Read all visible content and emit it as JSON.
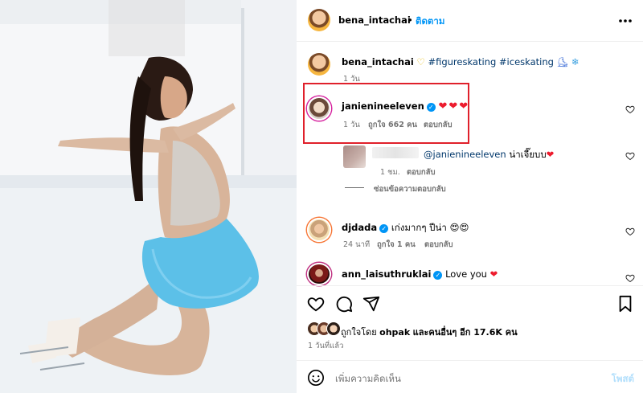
{
  "post": {
    "author": "bena_intachai",
    "follow_label": "ติดตาม",
    "separator": "•",
    "more_icon": "more-horizontal-icon"
  },
  "caption": {
    "author": "bena_intachai",
    "hashtags": "#figureskating #iceskating",
    "emoji": "🫶 ⛸ ❄",
    "time": "1 วัน"
  },
  "comments": [
    {
      "user": "janienineeleven",
      "verified": true,
      "text": "❤❤❤",
      "time": "1 วัน",
      "likes": "ถูกใจ 662 คน",
      "reply_label": "ตอบกลับ"
    },
    {
      "user": "",
      "mention": "@janienineeleven",
      "text": "น่าเจี๊ยบบ",
      "emoji": "❤",
      "time": "1 ชม.",
      "reply_label": "ตอบกลับ",
      "hide_replies": "ซ่อนข้อความตอบกลับ"
    },
    {
      "user": "djdada",
      "verified": true,
      "text": "เก่งมากๆ ปีน่า",
      "emoji": "😍😍",
      "time": "24 นาที",
      "likes": "ถูกใจ 1 คน",
      "reply_label": "ตอบกลับ"
    },
    {
      "user": "ann_laisuthruklai",
      "verified": true,
      "text": "Love you",
      "emoji": "❤"
    }
  ],
  "likes": {
    "prefix": "ถูกใจโดย",
    "user": "ohpak",
    "suffix": "และคนอื่นๆ อีก 17.6K คน",
    "posted": "1 วันที่แล้ว"
  },
  "composer": {
    "placeholder": "เพิ่มความคิดเห็น",
    "post_label": "โพสต์"
  },
  "colors": {
    "accent": "#0095f6",
    "highlight_box": "#e0202b",
    "heart": "#ed1c2e",
    "dress": "#5cc0e8"
  }
}
